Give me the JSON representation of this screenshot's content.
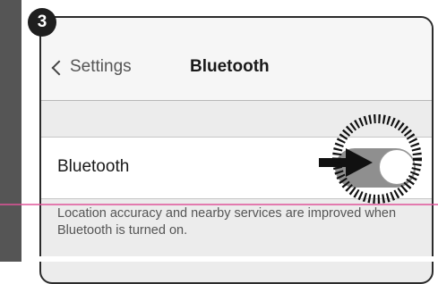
{
  "step": {
    "number": "3"
  },
  "navbar": {
    "back_label": "Settings",
    "title": "Bluetooth"
  },
  "bluetooth_cell": {
    "label": "Bluetooth",
    "toggle_state": "off"
  },
  "footer": {
    "text": "Location accuracy and nearby services are improved when Bluetooth is turned on."
  },
  "colors": {
    "badge": "#1f1f1f",
    "guide_line": "#e0559a",
    "toggle_track": "#8f8f8f"
  }
}
